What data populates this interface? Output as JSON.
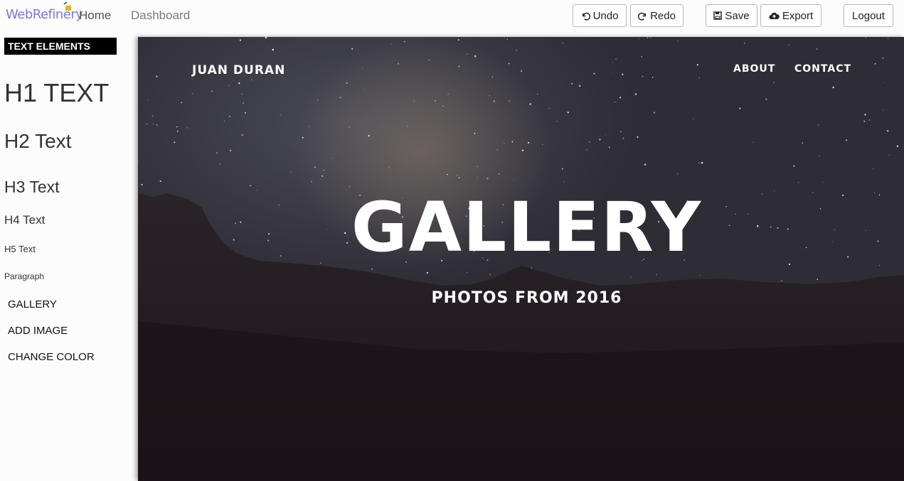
{
  "app": {
    "brand": "WebRefinery",
    "nav": {
      "home": "Home",
      "dashboard": "Dashboard"
    }
  },
  "toolbar": {
    "undo": "Undo",
    "redo": "Redo",
    "save": "Save",
    "export": "Export",
    "logout": "Logout"
  },
  "sidebar": {
    "header": "TEXT ELEMENTS",
    "items": {
      "h1": "H1 TEXT",
      "h2": "H2 Text",
      "h3": "H3 Text",
      "h4": "H4 Text",
      "h5": "H5 Text",
      "paragraph": "Paragraph"
    },
    "buttons": {
      "gallery": "GALLERY",
      "add_image": "ADD IMAGE",
      "change_color": "CHANGE COLOR"
    }
  },
  "page": {
    "nav": {
      "name": "JUAN DURAN",
      "about": "ABOUT",
      "contact": "CONTACT"
    },
    "title": "GALLERY",
    "subtitle": "PHOTOS FROM 2016"
  },
  "icons": {
    "undo": "undo-icon",
    "redo": "redo-icon",
    "save": "floppy-disk-icon",
    "export": "cloud-upload-icon"
  }
}
